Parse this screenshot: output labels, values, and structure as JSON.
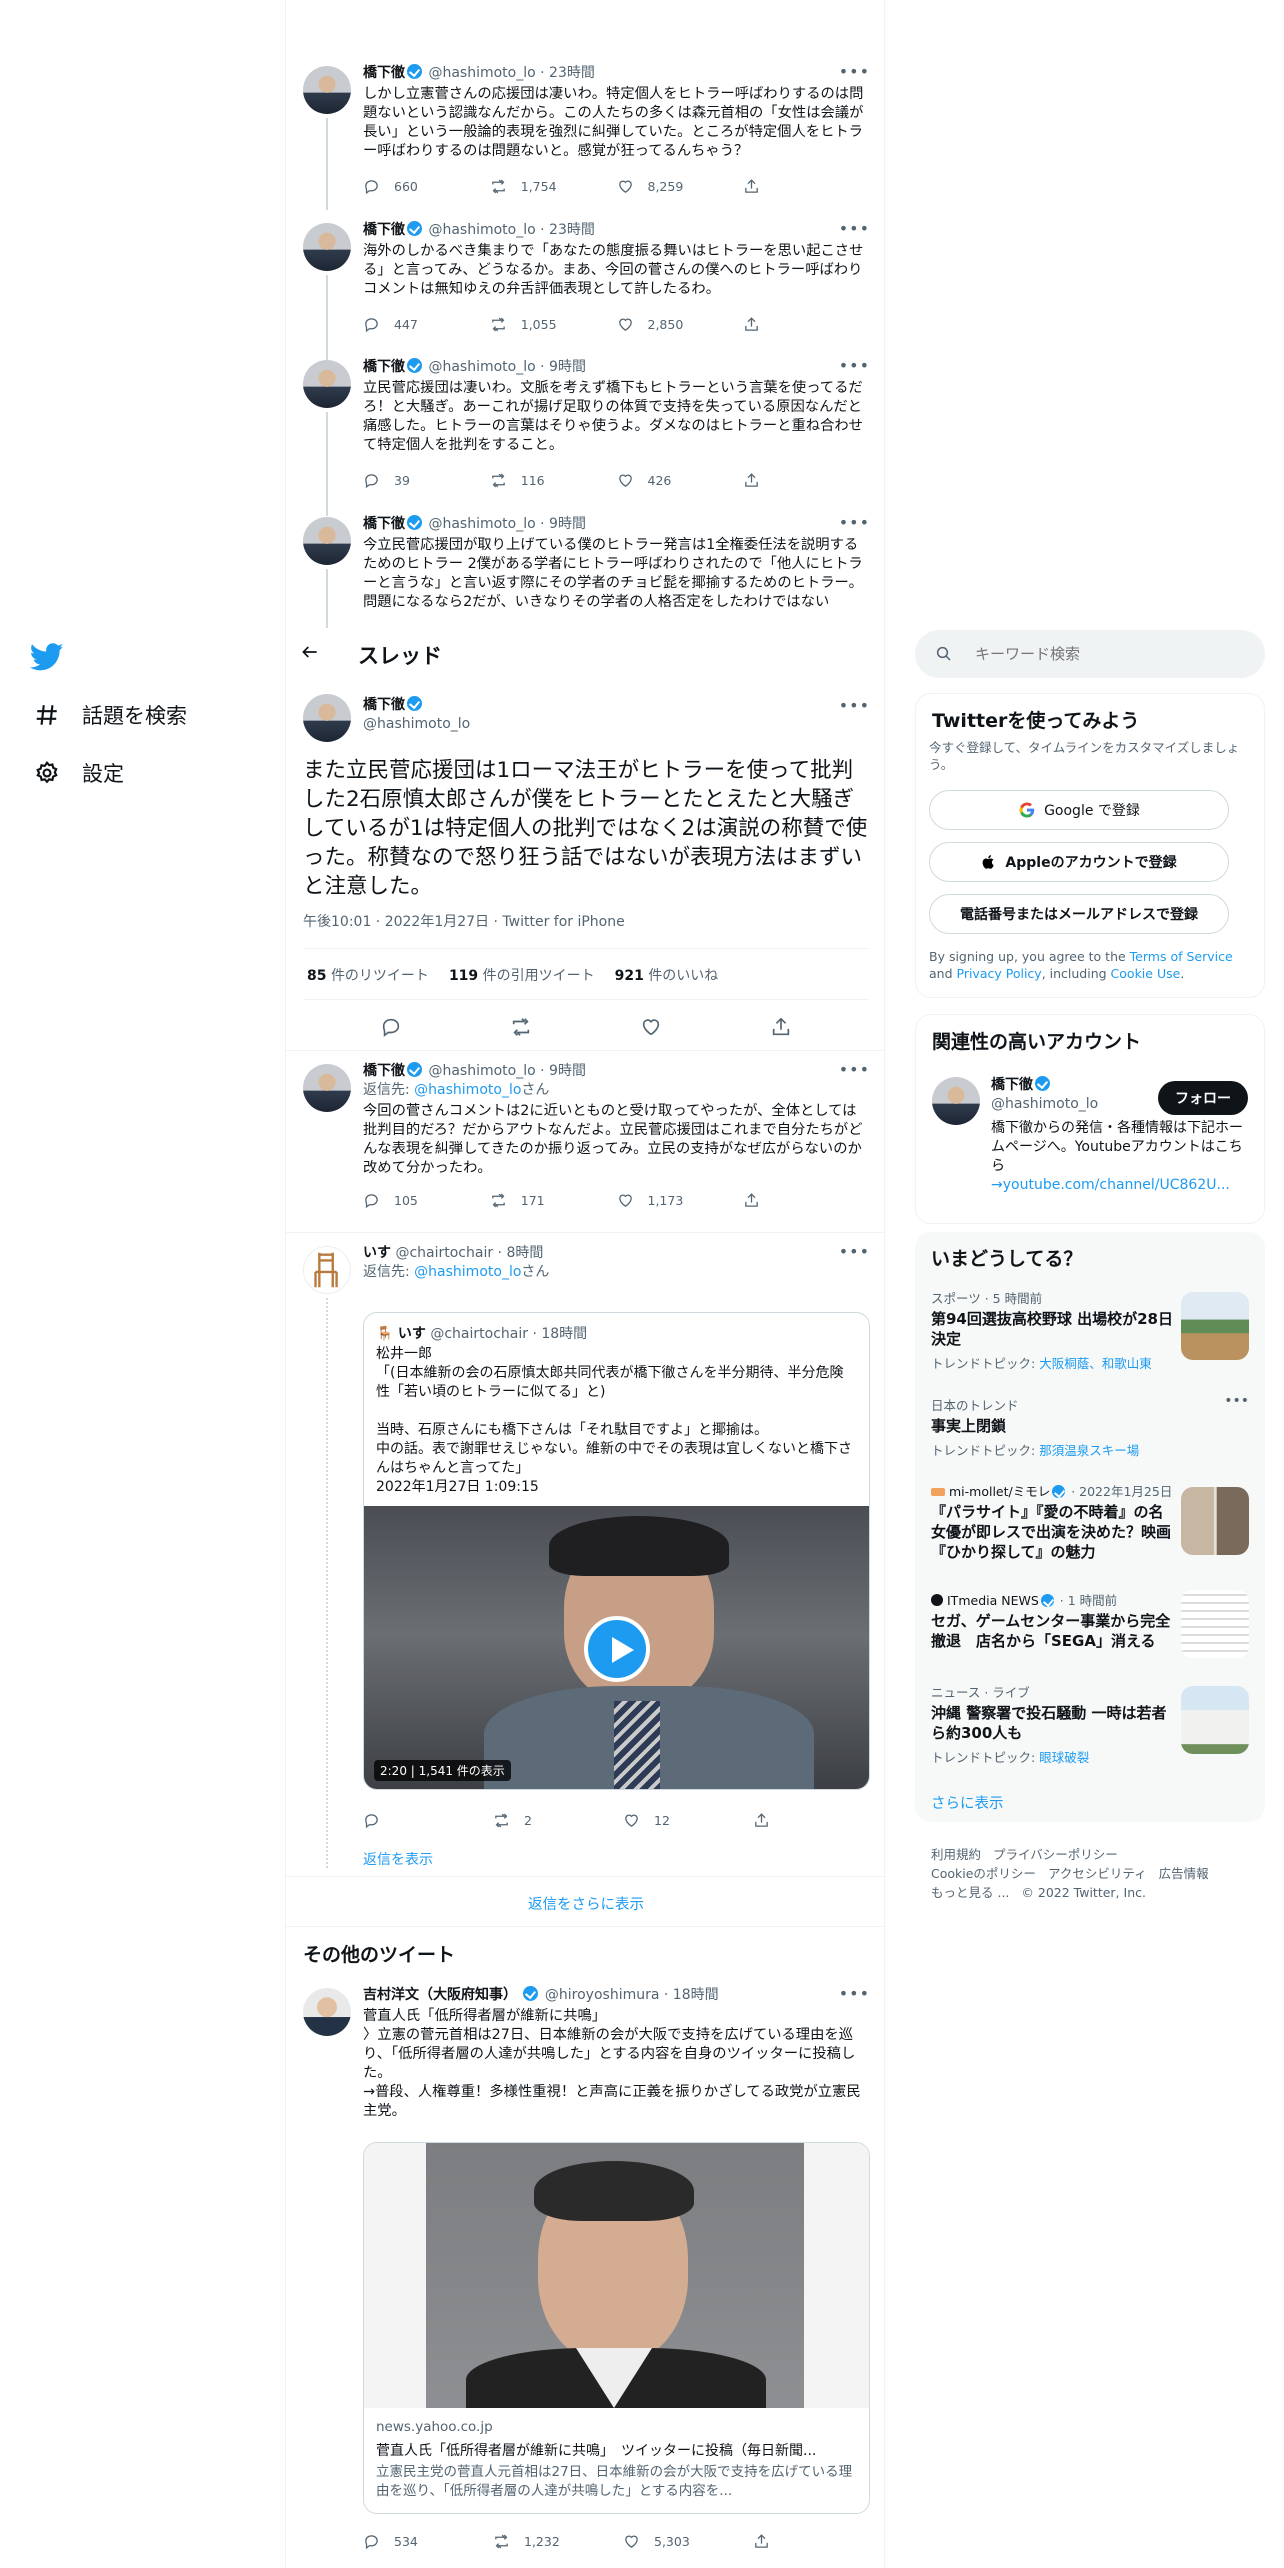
{
  "nav": {
    "explore_label": "話題を検索",
    "settings_label": "設定"
  },
  "tweets_above": [
    {
      "name": "橋下徹",
      "handle": "@hashimoto_lo",
      "time": "23時間",
      "text": "しかし立憲菅さんの応援団は凄いわ。特定個人をヒトラー呼ばわりするのは問題ないという認識なんだから。この人たちの多くは森元首相の「女性は会議が長い」という一般論的表現を強烈に糾弾していた。ところが特定個人をヒトラー呼ばわりするのは問題ないと。感覚が狂ってるんちゃう？",
      "replies": "660",
      "retweets": "1,754",
      "likes": "8,259"
    },
    {
      "name": "橋下徹",
      "handle": "@hashimoto_lo",
      "time": "23時間",
      "text": "海外のしかるべき集まりで「あなたの態度振る舞いはヒトラーを思い起こさせる」と言ってみ、どうなるか。まあ、今回の菅さんの僕へのヒトラー呼ばわりコメントは無知ゆえの弁舌評価表現として許したるわ。",
      "replies": "447",
      "retweets": "1,055",
      "likes": "2,850"
    },
    {
      "name": "橋下徹",
      "handle": "@hashimoto_lo",
      "time": "9時間",
      "text": "立民菅応援団は凄いわ。文脈を考えず橋下もヒトラーという言葉を使ってるだろ！と大騒ぎ。あーこれが揚げ足取りの体質で支持を失っている原因なんだと痛感した。ヒトラーの言葉はそりゃ使うよ。ダメなのはヒトラーと重ね合わせて特定個人を批判をすること。",
      "replies": "39",
      "retweets": "116",
      "likes": "426"
    },
    {
      "name": "橋下徹",
      "handle": "@hashimoto_lo",
      "time": "9時間",
      "text": "今立民菅応援団が取り上げている僕のヒトラー発言は1全権委任法を説明するためのヒトラー 2僕がある学者にヒトラー呼ばわりされたので「他人にヒトラーと言うな」と言い返す際にその学者のチョビ髭を揶揄するためのヒトラー。問題になるなら2だが、いきなりその学者の人格否定をしたわけではない"
    }
  ],
  "header": {
    "title": "スレッド"
  },
  "main_tweet": {
    "name": "橋下徹",
    "handle": "@hashimoto_lo",
    "text": "また立民菅応援団は1ローマ法王がヒトラーを使って批判した2石原慎太郎さんが僕をヒトラーとたとえたと大騒ぎしているが1は特定個人の批判ではなく2は演説の称賛で使った。称賛なので怒り狂う話ではないが表現方法はまずいと注意した。",
    "meta": "午後10:01 · 2022年1月27日 · Twitter for iPhone",
    "retweets_count": "85",
    "retweets_label": "件のリツイート",
    "quotes_count": "119",
    "quotes_label": "件の引用ツイート",
    "likes_count": "921",
    "likes_label": "件のいいね"
  },
  "reply1": {
    "name": "橋下徹",
    "handle": "@hashimoto_lo",
    "time": "9時間",
    "reply_to_label": "返信先:",
    "reply_to": "@hashimoto_lo",
    "reply_to_suffix": "さん",
    "text": "今回の菅さんコメントは2に近いとものと受け取ってやったが、全体としては批判目的だろ？だからアウトなんだよ。立民菅応援団はこれまで自分たちがどんな表現を糾弾してきたのか振り返ってみ。立民の支持がなぜ広がらないのか改めて分かったわ。",
    "replies": "105",
    "retweets": "171",
    "likes": "1,173"
  },
  "reply2": {
    "name": "いす",
    "handle": "@chairtochair",
    "time": "8時間",
    "reply_to_label": "返信先:",
    "reply_to": "@hashimoto_lo",
    "reply_to_suffix": "さん",
    "quote": {
      "name": "いす",
      "handle": "@chairtochair",
      "time": "18時間",
      "text_lines": [
        "松井一郎",
        "「(日本維新の会の石原慎太郎共同代表が橋下徹さんを半分期待、半分危険性「若い頃のヒトラーに似てる」と)",
        "",
        "当時、石原さんにも橋下さんは「それ駄目ですよ」と揶揄は。",
        "中の話。表で謝罪せえじゃない。維新の中でその表現は宜しくないと橋下さんはちゃんと言ってた」",
        "2022年1月27日 1:09:15"
      ],
      "video_duration": "2:20",
      "video_views": "1,541 件の表示"
    },
    "replies": "",
    "retweets": "2",
    "likes": "12",
    "show_replies": "返信を表示"
  },
  "more_replies": "返信をさらに表示",
  "other_tweets_title": "その他のツイート",
  "other_tweet": {
    "name": "吉村洋文（大阪府知事）",
    "handle": "@hiroyoshimura",
    "time": "18時間",
    "text": "菅直人氏「低所得者層が維新に共鳴」\n〉立憲の菅元首相は27日、日本維新の会が大阪で支持を広げている理由を巡り、「低所得者層の人達が共鳴した」とする内容を自身のツイッターに投稿した。\n→普段、人権尊重！多様性重視！と声高に正義を振りかざしてる政党が立憲民主党。",
    "card_domain": "news.yahoo.co.jp",
    "card_title": "菅直人氏「低所得者層が維新に共鳴」　ツイッターに投稿（毎日新聞...",
    "card_desc": "立憲民主党の菅直人元首相は27日、日本維新の会が大阪で支持を広げている理由を巡り、「低所得者層の人達が共鳴した」とする内容を...",
    "replies": "534",
    "retweets": "1,232",
    "likes": "5,303"
  },
  "right": {
    "search_placeholder": "キーワード検索",
    "signup": {
      "title": "Twitterを使ってみよう",
      "subtitle": "今すぐ登録して、タイムラインをカスタマイズしましょう。",
      "google": "Google で登録",
      "apple": "Appleのアカウントで登録",
      "phone": "電話番号またはメールアドレスで登録",
      "legal_1": "By signing up, you agree to the ",
      "legal_terms": "Terms of Service",
      "legal_2": " and ",
      "legal_privacy": "Privacy Policy",
      "legal_3": ", including ",
      "legal_cookie": "Cookie Use",
      "legal_4": "."
    },
    "related": {
      "title": "関連性の高いアカウント",
      "name": "橋下徹",
      "handle": "@hashimoto_lo",
      "follow": "フォロー",
      "bio": "橋下徹からの発信・各種情報は下記ホームページへ。Youtubeアカウントはこちら",
      "link": "→youtube.com/channel/UC862U..."
    },
    "trends": {
      "title": "いまどうしてる？",
      "items": [
        {
          "meta": "スポーツ · 5 時間前",
          "title": "第94回選抜高校野球 出場校が28日決定",
          "sub_label": "トレンドトピック: ",
          "sub_link": "大阪桐蔭、和歌山東"
        },
        {
          "meta": "日本のトレンド",
          "title": "事実上閉鎖",
          "sub_label": "トレンドトピック: ",
          "sub_link": "那須温泉スキー場"
        },
        {
          "meta_source": "mi-mollet/ミモレ",
          "meta_time": " · 2022年1月25日",
          "title": "『パラサイト』『愛の不時着』の名女優が即レスで出演を決めた？映画『ひかり探して』の魅力"
        },
        {
          "meta_source": "ITmedia NEWS",
          "meta_time": " · 1 時間前",
          "title": "セガ、ゲームセンター事業から完全撤退　店名から「SEGA」消える"
        },
        {
          "meta": "ニュース · ライブ",
          "title": "沖縄 警察署で投石騒動 一時は若者ら約300人も",
          "sub_label": "トレンドトピック: ",
          "sub_link": "眼球破裂"
        }
      ],
      "more": "さらに表示"
    },
    "footer": {
      "links": [
        "利用規約",
        "プライバシーポリシー",
        "Cookieのポリシー",
        "アクセシビリティ",
        "広告情報",
        "もっと見る ..."
      ],
      "copyright": "© 2022 Twitter, Inc."
    }
  },
  "colors": {
    "accent": "#1d9bf0",
    "text": "#0f1419",
    "muted": "#536471"
  }
}
